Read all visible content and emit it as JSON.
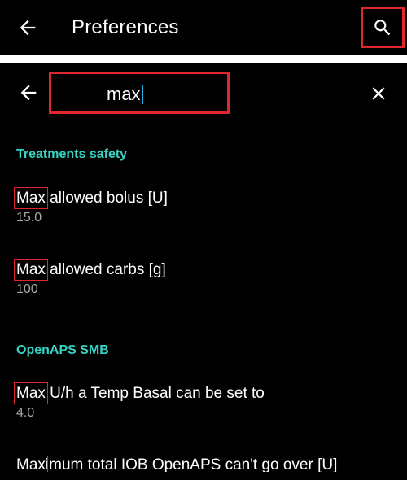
{
  "header": {
    "title": "Preferences",
    "back_icon": "arrow-left-icon",
    "search_icon": "search-icon"
  },
  "search": {
    "value": "max",
    "back_icon": "arrow-left-icon",
    "clear_icon": "close-icon"
  },
  "sections": [
    {
      "category": "Treatments safety",
      "items": [
        {
          "highlight": "Max",
          "rest": " allowed bolus [U]",
          "summary": "15.0"
        },
        {
          "highlight": "Max",
          "rest": " allowed carbs [g]",
          "summary": "100"
        }
      ]
    },
    {
      "category": "OpenAPS SMB",
      "items": [
        {
          "highlight": "Max",
          "rest": " U/h a Temp Basal can be set to",
          "summary": "4.0"
        },
        {
          "highlight": "Max",
          "rest": "imum total IOB OpenAPS can't go over [U]",
          "summary": ""
        }
      ]
    }
  ],
  "colors": {
    "accent": "#35d3c3",
    "highlight_box": "#e0262f",
    "caret": "#29a9e1"
  }
}
